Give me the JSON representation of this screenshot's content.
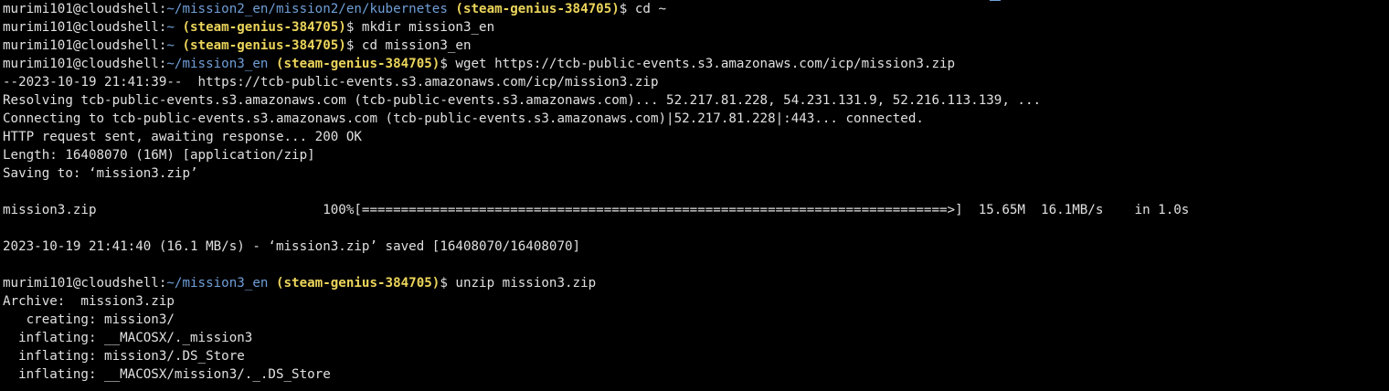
{
  "theme": {
    "background": "#000000",
    "text": "#e0e0e0",
    "path_color": "#6f9fd8",
    "project_color": "#ecd55b"
  },
  "terminal": {
    "lines": [
      {
        "type": "prompt",
        "user_host": "murimi101@cloudshell:",
        "path": "~/mission2_en/mission2/en/kubernetes",
        "project": "(steam-genius-384705)",
        "command": "$ cd ~"
      },
      {
        "type": "prompt",
        "user_host": "murimi101@cloudshell:",
        "path": "~",
        "project": "(steam-genius-384705)",
        "command": "$ mkdir mission3_en"
      },
      {
        "type": "prompt",
        "user_host": "murimi101@cloudshell:",
        "path": "~",
        "project": "(steam-genius-384705)",
        "command": "$ cd mission3_en"
      },
      {
        "type": "prompt",
        "user_host": "murimi101@cloudshell:",
        "path": "~/mission3_en",
        "project": "(steam-genius-384705)",
        "command": "$ wget https://tcb-public-events.s3.amazonaws.com/icp/mission3.zip"
      },
      {
        "type": "output",
        "text": "--2023-10-19 21:41:39--  https://tcb-public-events.s3.amazonaws.com/icp/mission3.zip"
      },
      {
        "type": "output",
        "text": "Resolving tcb-public-events.s3.amazonaws.com (tcb-public-events.s3.amazonaws.com)... 52.217.81.228, 54.231.131.9, 52.216.113.139, ..."
      },
      {
        "type": "output",
        "text": "Connecting to tcb-public-events.s3.amazonaws.com (tcb-public-events.s3.amazonaws.com)|52.217.81.228|:443... connected."
      },
      {
        "type": "output",
        "text": "HTTP request sent, awaiting response... 200 OK"
      },
      {
        "type": "output",
        "text": "Length: 16408070 (16M) [application/zip]"
      },
      {
        "type": "output",
        "text": "Saving to: ‘mission3.zip’"
      },
      {
        "type": "output",
        "text": ""
      },
      {
        "type": "output",
        "text": "mission3.zip                             100%[===========================================================================>]  15.65M  16.1MB/s    in 1.0s"
      },
      {
        "type": "output",
        "text": ""
      },
      {
        "type": "output",
        "text": "2023-10-19 21:41:40 (16.1 MB/s) - ‘mission3.zip’ saved [16408070/16408070]"
      },
      {
        "type": "output",
        "text": ""
      },
      {
        "type": "prompt",
        "user_host": "murimi101@cloudshell:",
        "path": "~/mission3_en",
        "project": "(steam-genius-384705)",
        "command": "$ unzip mission3.zip"
      },
      {
        "type": "output",
        "text": "Archive:  mission3.zip"
      },
      {
        "type": "output",
        "text": "   creating: mission3/"
      },
      {
        "type": "output",
        "text": "  inflating: __MACOSX/._mission3"
      },
      {
        "type": "output",
        "text": "  inflating: mission3/.DS_Store"
      },
      {
        "type": "output",
        "text": "  inflating: __MACOSX/mission3/._.DS_Store"
      }
    ]
  }
}
